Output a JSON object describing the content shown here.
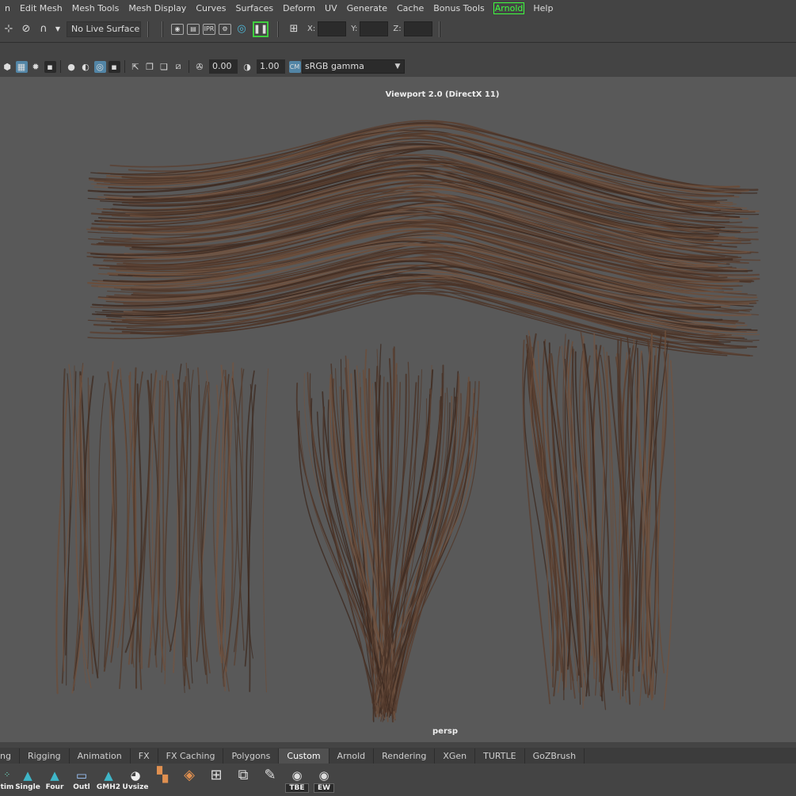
{
  "menus": [
    "n",
    "Edit Mesh",
    "Mesh Tools",
    "Mesh Display",
    "Curves",
    "Surfaces",
    "Deform",
    "UV",
    "Generate",
    "Cache",
    "Bonus Tools",
    "Arnold",
    "Help"
  ],
  "status_line": {
    "live_surface": "No Live Surface",
    "x_label": "X:",
    "y_label": "Y:",
    "z_label": "Z:",
    "x_value": "",
    "y_value": "",
    "z_value": ""
  },
  "panel_toolbar": {
    "exposure": "0.00",
    "gamma_value": "1.00",
    "color_space": "sRGB gamma"
  },
  "viewport": {
    "renderer_label": "Viewport 2.0 (DirectX 11)",
    "camera": "persp"
  },
  "shelf_tabs": [
    "ng",
    "Rigging",
    "Animation",
    "FX",
    "FX Caching",
    "Polygons",
    "Custom",
    "Arnold",
    "Rendering",
    "XGen",
    "TURTLE",
    "GoZBrush"
  ],
  "active_shelf_tab": "Custom",
  "shelf_buttons": [
    {
      "label": "tim",
      "icon": "anim-icon"
    },
    {
      "label": "Single",
      "icon": "maya-single-icon"
    },
    {
      "label": "Four",
      "icon": "maya-four-icon"
    },
    {
      "label": "Outl",
      "icon": "outliner-icon"
    },
    {
      "label": "GMH2",
      "icon": "maya-gmh2-icon"
    },
    {
      "label": "Uvsize",
      "icon": "uvsize-icon"
    },
    {
      "label": "",
      "icon": "layout-icon"
    },
    {
      "label": "",
      "icon": "snap-icon"
    },
    {
      "label": "",
      "icon": "grid-icon"
    },
    {
      "label": "",
      "icon": "pivot-icon"
    },
    {
      "label": "",
      "icon": "paint-icon"
    },
    {
      "label": "TBE",
      "icon": "eye-icon"
    },
    {
      "label": "EW",
      "icon": "eye-icon"
    }
  ],
  "colors": {
    "viewport_bg": "#595959",
    "hair": "#5a4132",
    "active_highlight": "#5285a6",
    "arnold_green": "#3fff3f"
  }
}
